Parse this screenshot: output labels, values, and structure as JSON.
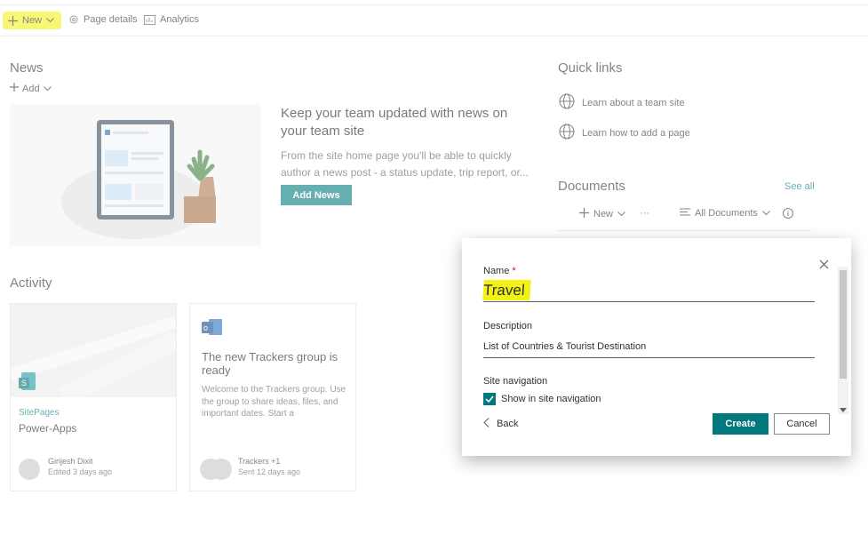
{
  "commandbar": {
    "new_label": "New",
    "page_details_label": "Page details",
    "analytics_label": "Analytics"
  },
  "news": {
    "title": "News",
    "add_label": "Add",
    "heading": "Keep your team updated with news on your team site",
    "body": "From the site home page you'll be able to quickly author a news post - a status update, trip report, or...",
    "button": "Add News"
  },
  "quick_links": {
    "title": "Quick links",
    "items": [
      {
        "label": "Learn about a team site"
      },
      {
        "label": "Learn how to add a page"
      }
    ]
  },
  "documents": {
    "title": "Documents",
    "see_all": "See all",
    "new_label": "New",
    "more": "···",
    "view_label": "All Documents"
  },
  "activity": {
    "title": "Activity",
    "cards": [
      {
        "tag": "SitePages",
        "title": "Power-Apps",
        "author": "Girijesh Dixit",
        "meta": "Edited 3 days ago"
      },
      {
        "title": "The new Trackers group is ready",
        "body": "Welcome to the Trackers group. Use the group to share ideas, files, and important dates. Start a",
        "author": "Trackers +1",
        "meta": "Sent 12 days ago"
      }
    ]
  },
  "dialog": {
    "name_label": "Name",
    "required_mark": "*",
    "name_value": "Travel",
    "description_label": "Description",
    "description_value": "List of Countries & Tourist Destination",
    "site_nav_label": "Site navigation",
    "show_in_nav_label": "Show in site navigation",
    "show_in_nav_checked": true,
    "back_label": "Back",
    "create_label": "Create",
    "cancel_label": "Cancel"
  },
  "colors": {
    "accent": "#03787c",
    "highlight": "#f3f218"
  }
}
